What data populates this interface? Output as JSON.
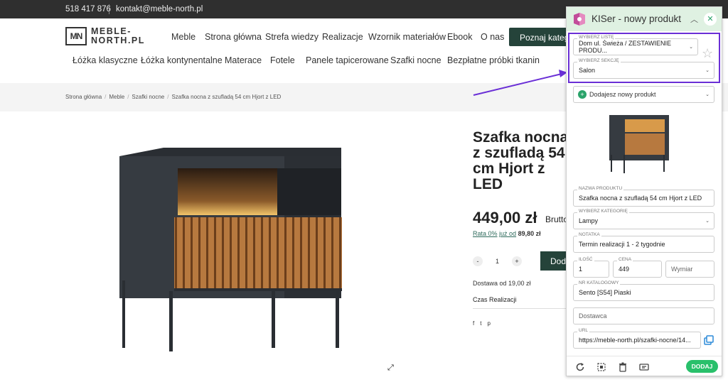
{
  "topbar": {
    "phone": "518 417 876",
    "email": "kontakt@meble-north.pl"
  },
  "logo": {
    "mark": "MN",
    "line1": "MEBLE-",
    "line2": "NORTH.PL"
  },
  "nav_main": [
    "Meble",
    "Strona główna",
    "Strefa wiedzy",
    "Realizacje",
    "Wzornik materiałów",
    "Ebook",
    "O nas"
  ],
  "cta": "Poznaj kategorie",
  "nav_categories": [
    "Łóżka klasyczne",
    "Łóżka kontynentalne",
    "Materace",
    "Fotele",
    "Panele tapicerowane",
    "Szafki nocne",
    "Bezpłatne próbki tkanin"
  ],
  "breadcrumbs": [
    "Strona główna",
    "Meble",
    "Szafki nocne",
    "Szafka nocna z szufladą 54 cm Hjort z LED"
  ],
  "product": {
    "title": "Szafka nocna z szufladą 54 cm Hjort z LED",
    "price": "449,00 zł",
    "price_suffix": "Brutto",
    "rata_prefix": "Rata 0%",
    "rata_mid": "już od",
    "rata_value": "89,80 zł",
    "qty_minus": "-",
    "qty": "1",
    "qty_plus": "+",
    "add_label": "Dodaj do koszyka",
    "delivery": "Dostawa od 19,00 zł",
    "czas": "Czas Realizacji",
    "social": [
      "f",
      "t",
      "p"
    ]
  },
  "panel": {
    "title": "KISer - nowy produkt",
    "list_label": "WYBIERZ LISTĘ",
    "list_value": "Dom ul. Świeża / ZESTAWIENIE PRODU...",
    "section_label": "WYBIERZ SEKCJĘ",
    "section_value": "Salon",
    "add_mode": "Dodajesz nowy produkt",
    "name_label": "NAZWA PRODUKTU",
    "name_value": "Szafka nocna z szufladą 54 cm Hjort z LED",
    "category_label": "WYBIERZ KATEGORIĘ",
    "category_value": "Lampy",
    "note_label": "NOTATKA",
    "note_value": "Termin realizacji 1 - 2 tygodnie",
    "qty_label": "ILOŚĆ",
    "qty_value": "1",
    "price_label": "CENA",
    "price_value": "449",
    "dim_placeholder": "Wymiar",
    "catalog_label": "NR KATALOGOWY",
    "catalog_value": "Sento [S54] Piaski",
    "supplier_placeholder": "Dostawca",
    "url_label": "URL",
    "url_value": "https://meble-north.pl/szafki-nocne/14...",
    "submit": "DODAJ"
  },
  "colors": {
    "brand_dark": "#25433a",
    "panel_header": "#dff1e2",
    "accent_green": "#29c06b",
    "highlight": "#6a2fd6"
  }
}
